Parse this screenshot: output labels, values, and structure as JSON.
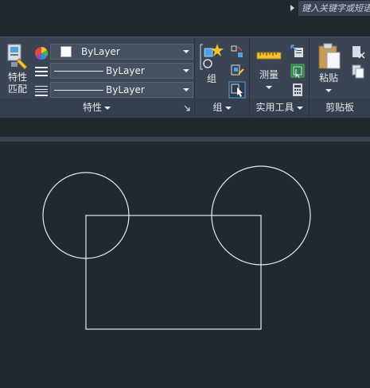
{
  "search": {
    "placeholder": "键入关键字或短语"
  },
  "properties_panel": {
    "match_button_line1": "特性",
    "match_button_line2": "匹配",
    "color_value": "ByLayer",
    "linetype_value": "ByLayer",
    "lineweight_value": "ByLayer",
    "footer_label": "特性"
  },
  "groups_panel": {
    "group_label": "组",
    "footer_label": "组"
  },
  "utilities_panel": {
    "measure_label": "测量",
    "footer_label": "实用工具"
  },
  "clipboard_panel": {
    "paste_label": "粘贴",
    "footer_label": "剪贴板"
  },
  "colors": {
    "ribbon_bg": "#3b4453",
    "canvas_bg": "#212830",
    "geometry": "#e8eaed",
    "accent_blue": "#4da3e0"
  },
  "drawing": {
    "entities": [
      "circle",
      "circle",
      "rectangle"
    ]
  }
}
